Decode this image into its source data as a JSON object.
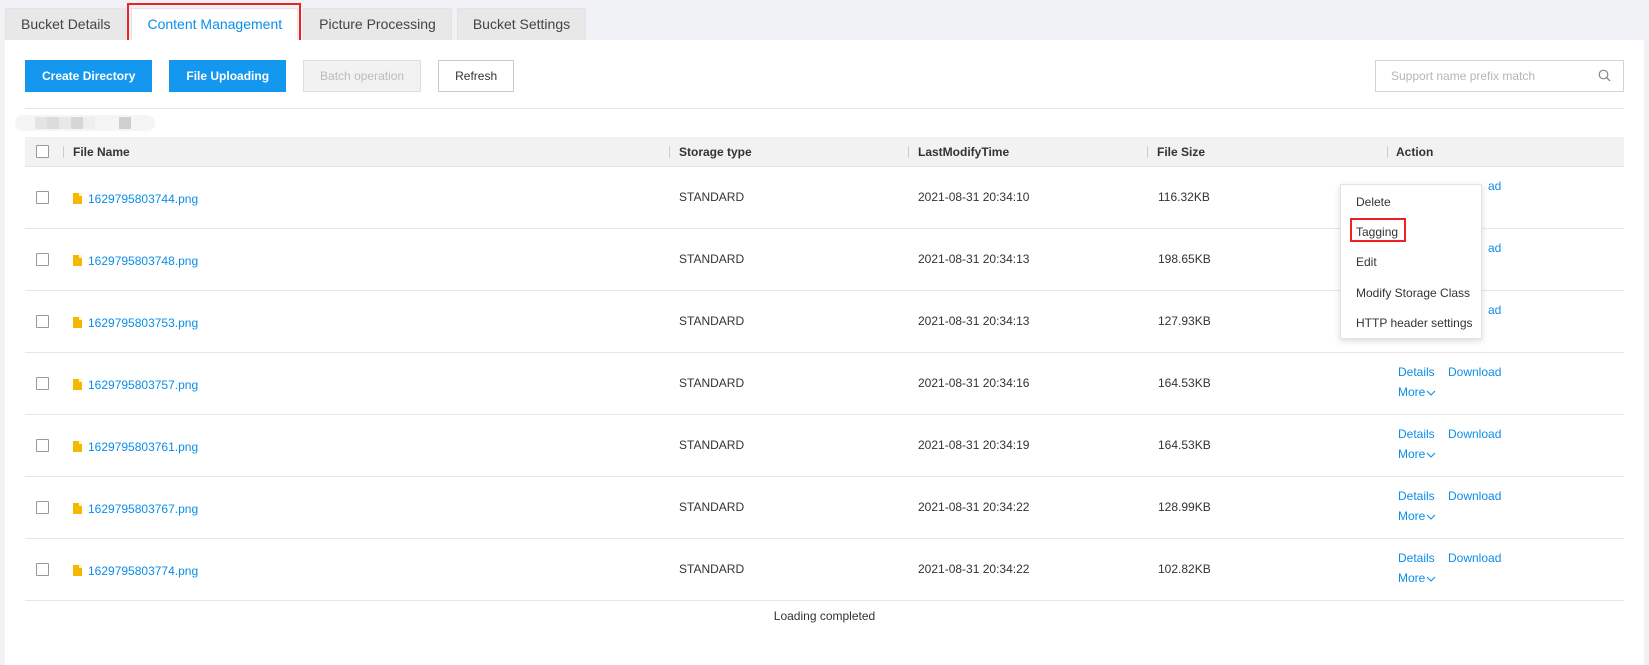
{
  "tabs": [
    {
      "label": "Bucket Details",
      "active": false
    },
    {
      "label": "Content Management",
      "active": true
    },
    {
      "label": "Picture Processing",
      "active": false
    },
    {
      "label": "Bucket Settings",
      "active": false
    }
  ],
  "toolbar": {
    "create_directory": "Create Directory",
    "file_uploading": "File Uploading",
    "batch_operation": "Batch operation",
    "refresh": "Refresh"
  },
  "search": {
    "placeholder": "Support name prefix match"
  },
  "table": {
    "columns": {
      "file_name": "File Name",
      "storage_type": "Storage type",
      "last_modify_time": "LastModifyTime",
      "file_size": "File Size",
      "action": "Action"
    },
    "rows": [
      {
        "name": "1629795803744.png",
        "storage": "STANDARD",
        "time": "2021-08-31 20:34:10",
        "size": "116.32KB"
      },
      {
        "name": "1629795803748.png",
        "storage": "STANDARD",
        "time": "2021-08-31 20:34:13",
        "size": "198.65KB"
      },
      {
        "name": "1629795803753.png",
        "storage": "STANDARD",
        "time": "2021-08-31 20:34:13",
        "size": "127.93KB"
      },
      {
        "name": "1629795803757.png",
        "storage": "STANDARD",
        "time": "2021-08-31 20:34:16",
        "size": "164.53KB"
      },
      {
        "name": "1629795803761.png",
        "storage": "STANDARD",
        "time": "2021-08-31 20:34:19",
        "size": "164.53KB"
      },
      {
        "name": "1629795803767.png",
        "storage": "STANDARD",
        "time": "2021-08-31 20:34:22",
        "size": "128.99KB"
      },
      {
        "name": "1629795803774.png",
        "storage": "STANDARD",
        "time": "2021-08-31 20:34:22",
        "size": "102.82KB"
      }
    ]
  },
  "actions": {
    "details": "Details",
    "download": "Download",
    "more": "More"
  },
  "dropdown": {
    "items": [
      "Delete",
      "Tagging",
      "Edit",
      "Modify Storage Class",
      "HTTP header settings"
    ],
    "partial_download": "ad"
  },
  "footer": {
    "loading": "Loading completed"
  },
  "icons": {
    "search": "search-icon",
    "file": "file-icon",
    "more": "chevron-down-icon"
  },
  "colors": {
    "accent": "#1497ef",
    "link": "#0a8ee8",
    "highlight": "#e22222",
    "file_icon": "#f5b800"
  }
}
